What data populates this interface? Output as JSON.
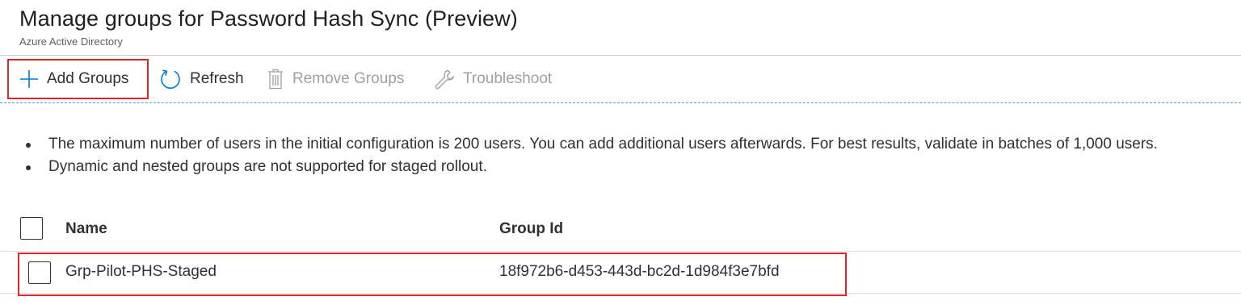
{
  "header": {
    "title": "Manage groups for Password Hash Sync (Preview)",
    "subtitle": "Azure Active Directory"
  },
  "toolbar": {
    "add_groups": "Add Groups",
    "refresh": "Refresh",
    "remove_groups": "Remove Groups",
    "troubleshoot": "Troubleshoot",
    "icons": {
      "add": "plus-icon",
      "refresh": "refresh-icon",
      "remove": "trash-icon",
      "troubleshoot": "wrench-icon"
    }
  },
  "notes": [
    "The maximum number of users in the initial configuration is 200 users. You can add additional users afterwards. For best results, validate in batches of 1,000 users.",
    "Dynamic and nested groups are not supported for staged rollout."
  ],
  "table": {
    "columns": [
      "Name",
      "Group Id"
    ],
    "rows": [
      {
        "name": "Grp-Pilot-PHS-Staged",
        "group_id": "18f972b6-d453-443d-bc2d-1d984f3e7bfd"
      }
    ]
  },
  "colors": {
    "highlight": "#e0242b",
    "accent": "#0078d4",
    "disabled": "#a19f9d"
  }
}
